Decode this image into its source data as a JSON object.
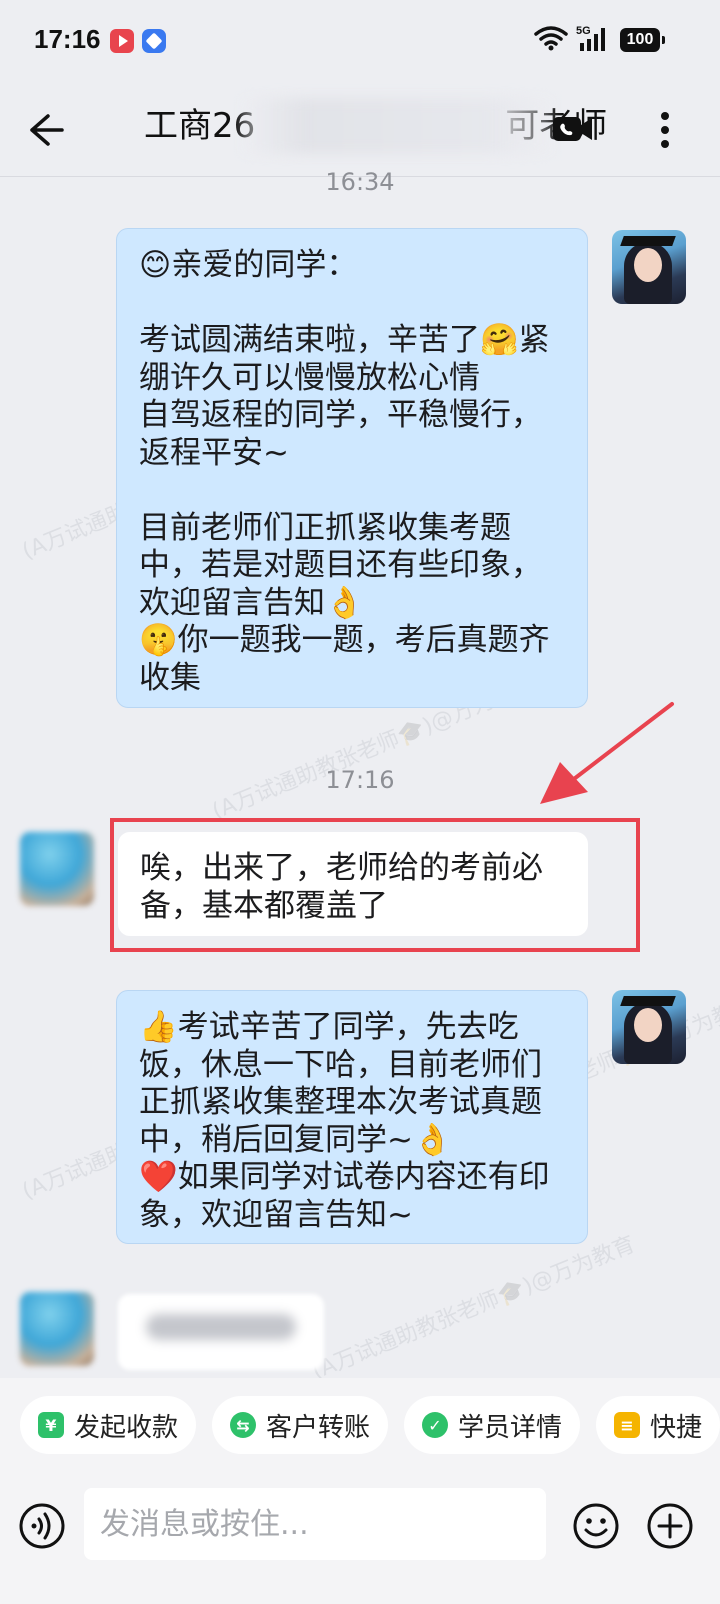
{
  "status_bar": {
    "time": "17:16",
    "network": "5G",
    "battery": "100"
  },
  "header": {
    "title": "工商26",
    "title_suffix": "可老师"
  },
  "timestamps": [
    "16:34",
    "17:16"
  ],
  "messages": [
    {
      "from": "teacher",
      "text": "😊亲爱的同学：\n\n考试圆满结束啦，辛苦了🤗紧绷许久可以慢慢放松心情\n自驾返程的同学，平稳慢行，返程平安~\n\n目前老师们正抓紧收集考题中，若是对题目还有些印象，欢迎留言告知👌\n🤫你一题我一题，考后真题齐收集"
    },
    {
      "from": "student",
      "text": "唉，出来了，老师给的考前必备，基本都覆盖了"
    },
    {
      "from": "teacher",
      "text": "👍考试辛苦了同学，先去吃饭，休息一下哈，目前老师们正抓紧收集整理本次考试真题中，稍后回复同学~👌\n❤️如果同学对试卷内容还有印象，欢迎留言告知~"
    }
  ],
  "watermark": "(A万试通助教张老师🎓)@万为教育",
  "quick_actions": [
    {
      "label": "发起收款",
      "icon": "¥",
      "color": "#2ec16a"
    },
    {
      "label": "客户转账",
      "icon": "⇆",
      "color": "#2ec16a"
    },
    {
      "label": "学员详情",
      "icon": "✓",
      "color": "#2ec16a"
    },
    {
      "label": "快捷",
      "icon": "≡",
      "color": "#f5b400"
    }
  ],
  "input": {
    "placeholder": "发消息或按住..."
  },
  "colors": {
    "bubble_out": "#cfe8ff",
    "highlight": "#e8434f"
  }
}
